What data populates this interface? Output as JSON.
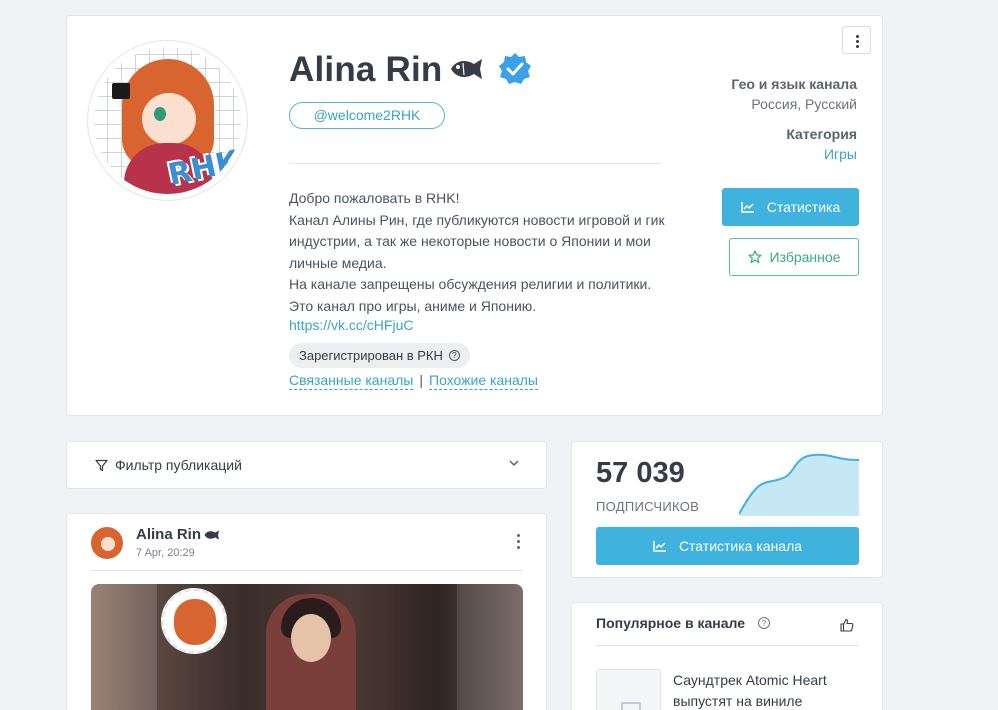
{
  "channel": {
    "name": "Alina Rin",
    "handle": "@welcome2RHK",
    "description": "Добро пожаловать в RHK!\nКанал Алины Рин, где публикуются новости игровой и гик индустрии, а так же некоторые новости о Японии и мои личные медиа.\nНа канале запрещены обсуждения религии и политики.\nЭто канал про игры, аниме и Японию.",
    "link": "https://vk.cc/cHFjuC",
    "rkn_badge": "Зарегистрирован в РКН",
    "related_link": "Связанные каналы",
    "related_separator": "|",
    "similar_link": "Похожие каналы",
    "avatar_text": "RHK"
  },
  "sidebar_info": {
    "geo_label": "Гео и язык канала",
    "geo_value": "Россия, Русский",
    "category_label": "Категория",
    "category_value": "Игры",
    "stats_button": "Статистика",
    "favorite_button": "Избранное"
  },
  "filter": {
    "label": "Фильтр публикаций"
  },
  "post": {
    "author": "Alina Rin",
    "date": "7 Apr, 20:29"
  },
  "subscribers": {
    "count": "57 039",
    "label": "подписчиков",
    "button": "Статистика канала"
  },
  "popular": {
    "title": "Популярное в канале",
    "item_title": "Саундтрек Atomic Heart выпустят на виниле"
  },
  "colors": {
    "accent": "#3fb3de",
    "favorite": "#55c1a0",
    "link": "#3aa3c9",
    "verified": "#3aa0e8"
  }
}
